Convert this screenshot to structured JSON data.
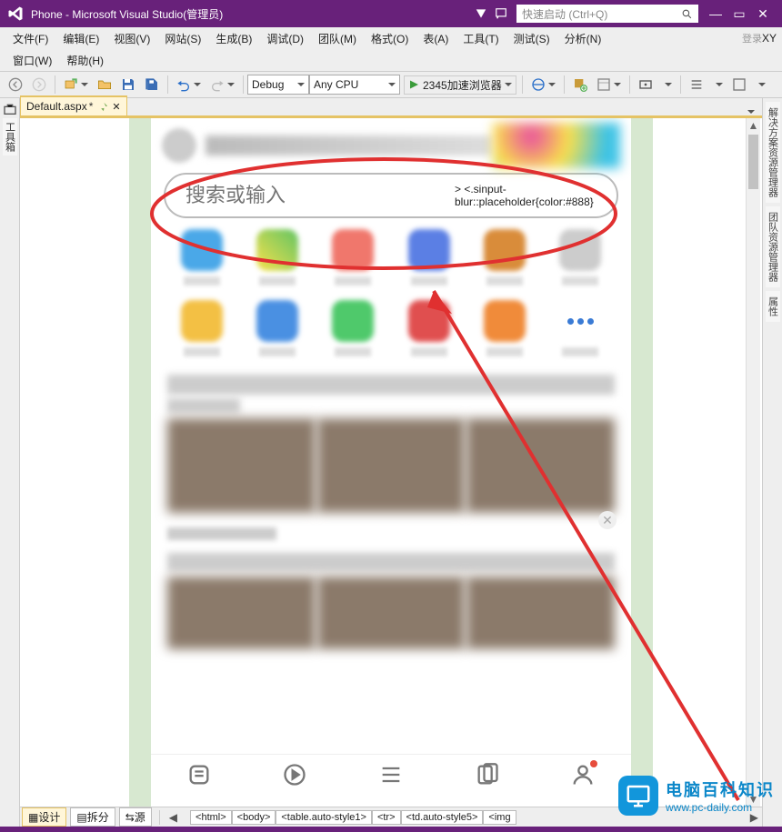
{
  "titlebar": {
    "title": "Phone - Microsoft Visual Studio(管理员)",
    "quicklaunch_placeholder": "快速启动 (Ctrl+Q)",
    "account_initials": "XY"
  },
  "menu": {
    "items": [
      "文件(F)",
      "编辑(E)",
      "视图(V)",
      "网站(S)",
      "生成(B)",
      "调试(D)",
      "团队(M)",
      "格式(O)",
      "表(A)",
      "工具(T)",
      "测试(S)",
      "分析(N)"
    ],
    "row2": [
      "窗口(W)",
      "帮助(H)"
    ],
    "signin": "登录"
  },
  "toolbar": {
    "config": "Debug",
    "platform": "Any CPU",
    "run_label": "2345加速浏览器"
  },
  "left_rail": {
    "toolbox": "工具箱"
  },
  "right_rail": {
    "tabs": [
      "解决方案资源管理器",
      "团队资源管理器",
      "属性"
    ]
  },
  "doctab": {
    "name": "Default.aspx",
    "dirty": "*"
  },
  "search": {
    "placeholder": "搜索或输入"
  },
  "design_row": {
    "design": "设计",
    "split": "拆分",
    "source": "源",
    "crumbs": [
      "<html>",
      "<body>",
      "<table.auto-style1>",
      "<tr>",
      "<td.auto-style5>",
      "<img"
    ]
  },
  "watermark": {
    "cn": "电脑百科知识",
    "url": "www.pc-daily.com"
  }
}
